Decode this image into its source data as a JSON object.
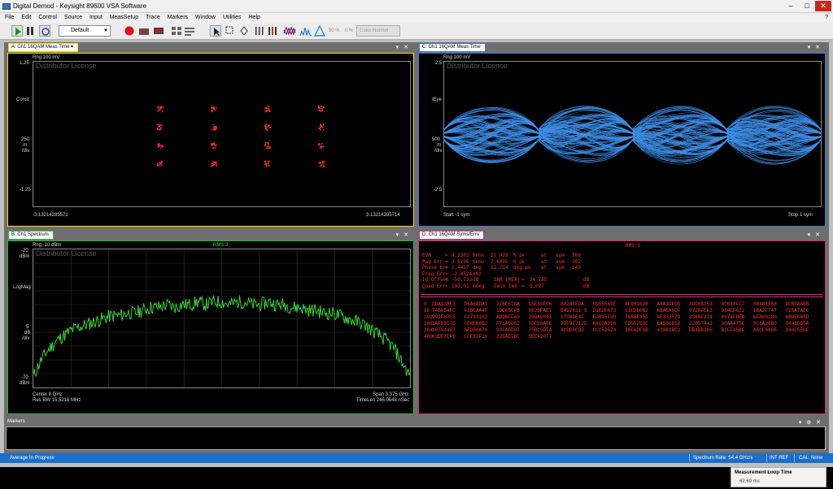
{
  "window": {
    "title": "Digital Demod - Keysight 89600 VSA Software"
  },
  "menu": [
    "File",
    "Edit",
    "Control",
    "Source",
    "Input",
    "MeasSetup",
    "Trace",
    "Markers",
    "Window",
    "Utilities",
    "Help"
  ],
  "toolbar": {
    "preset_value": "Default",
    "percent1": "50 %",
    "percent2": "0 %",
    "color_mode": "Color Normal"
  },
  "pane_a": {
    "tab": "A: Ch1 16QAM Meas Time",
    "range": "Rng 100 mV",
    "license": "Distributor License",
    "y_labels": [
      "1.25",
      "Const",
      "250",
      "m",
      "/div",
      "-1.25"
    ],
    "x_start": "-3.13214285571",
    "x_stop": "3.13214285714"
  },
  "pane_c": {
    "tab": "C: Ch1 16QAM Meas Time",
    "range": "Rng 100 mV",
    "license": "Distributor License",
    "y_labels": [
      "2.5",
      "IEye",
      "500",
      "m",
      "/div",
      "-2.5"
    ],
    "x_start": "Start -1  sym",
    "x_stop": "Stop 1  sym"
  },
  "pane_b": {
    "tab": "B: Ch1 Spectrum",
    "range": "Rng -10 dBm",
    "rms": "RMS:3",
    "license": "Distributor License",
    "y_labels": [
      "-20",
      "dBm",
      "LogMag",
      "5",
      "dB",
      "/div",
      "-70",
      "dBm"
    ],
    "center": "Center 8 GHz",
    "res_bw": "Res BW 15.5218 MHz",
    "span": "Span 3.375 GHz",
    "timelen": "TimeLen 246.0648 nSec"
  },
  "pane_d": {
    "tab": "D: Ch1 16QAM Syms/Errs",
    "rms": "RMS:3",
    "stats": [
      [
        "EVM",
        "=",
        "4.3382",
        "%rms",
        "11.039",
        "% pk",
        "at",
        "sym",
        "360"
      ],
      [
        "Mag Err",
        "=",
        "2.8795",
        "%rms",
        "7.6495",
        "% pk",
        "at",
        "sym",
        "382"
      ],
      [
        "Phase Err",
        "=",
        "2.4417",
        "deg",
        "12.724",
        "deg pk",
        "at",
        "sym",
        "149"
      ],
      [
        "Freq Err",
        "=",
        "-2.4524",
        "kHz",
        "",
        "",
        "",
        "",
        ""
      ],
      [
        "IQ Offset",
        "=",
        "-50.733",
        "dB",
        "SNR (MER)",
        "=",
        "24.785",
        "dB",
        ""
      ],
      [
        "Quad Err",
        "=",
        "193.01",
        "mdeg",
        "Gain Imb",
        "=",
        "0.027",
        "dB",
        ""
      ]
    ],
    "symbols": [
      [
        "0",
        "DDA13BE3",
        "D6A6BDA3",
        "27BC616A",
        "1BE39FC6",
        "B0287EDA",
        "CD55569E",
        "9F981698",
        "A4A3DFD8",
        "1DD0B153",
        "4C618FC7",
        "8B4B1588",
        "DCB0A6BB"
      ],
      [
        "96",
        "74B054FC",
        "F1BCAA4F",
        "1DC65CFB",
        "8820FAE7",
        "B497811 9",
        "D1E2E673",
        "51ED60B2",
        "6BA6A6DF",
        "9720FEF3",
        "984EF622",
        "1BA2F747",
        "725A7AEC"
      ],
      [
        "192",
        "991F8853",
        "C2733183",
        "AD9BFF40",
        "298A6893",
        "17C0DE4F",
        "EDD15F9D",
        "768BE35D",
        "0E33357D",
        "2369F234",
        "8674FBEA",
        "6FB09180",
        "8BDE0B0D"
      ],
      [
        "288",
        "1AFB8C7E",
        "CE8EB8B2",
        "F71A6D02",
        "7DCE8A0E",
        "99F92712D",
        "A810A990",
        "CD55769C",
        "6AD6CB58",
        "22657443",
        "30AA475E",
        "8C6A26B0",
        "044BDD5A"
      ],
      [
        "384",
        "16754497",
        "5ED56A78",
        "98FA0D07",
        "75BC5DFA",
        "4CDD6C9D",
        "CCC52624",
        "38F6DF6B",
        "430B1BC2",
        "DB4BB385",
        "B2FF45BF",
        "A5CF666B",
        "994C55BF"
      ],
      [
        "480",
        "03DC7EF9",
        "CCF52F16",
        "325AE9BC",
        "5EE42077",
        "",
        "",
        "",
        "",
        "",
        "",
        "",
        ""
      ]
    ]
  },
  "markers_panel": {
    "title": "Markers"
  },
  "status": {
    "message": "Average In Progress",
    "spectrum_rate": "Spectrum Rate: 54.4 GHz/s",
    "ref": "INT REF",
    "cal": "CAL: None"
  },
  "toast": {
    "title": "Measurement Loop Time",
    "value": "62.69 ms"
  },
  "chart_data": [
    {
      "type": "scatter",
      "title": "A: Ch1 16QAM Meas Time",
      "xlim": [
        -3.13214285571,
        3.13214285714
      ],
      "ylim": [
        -1.25,
        1.25
      ],
      "constellation_points": [
        [
          -3,
          3
        ],
        [
          -1,
          3
        ],
        [
          1,
          3
        ],
        [
          3,
          3
        ],
        [
          -3,
          1
        ],
        [
          -1,
          1
        ],
        [
          1,
          1
        ],
        [
          3,
          1
        ],
        [
          -3,
          -1
        ],
        [
          -1,
          -1
        ],
        [
          1,
          -1
        ],
        [
          3,
          -1
        ],
        [
          -3,
          -3
        ],
        [
          -1,
          -3
        ],
        [
          1,
          -3
        ],
        [
          3,
          -3
        ]
      ]
    },
    {
      "type": "line",
      "title": "B: Ch1 Spectrum",
      "ylabel": "LogMag",
      "ylim": [
        -70,
        -20
      ],
      "x_center_ghz": 8,
      "x_span_ghz": 3.375,
      "values": [
        -66,
        -60,
        -56,
        -53,
        -51,
        -49,
        -48,
        -47,
        -46,
        -45,
        -44,
        -44,
        -43,
        -43,
        -42,
        -41,
        -41,
        -40,
        -41,
        -40,
        -40,
        -39,
        -40,
        -39,
        -39,
        -40,
        -39,
        -39,
        -40,
        -40,
        -39,
        -40,
        -40,
        -41,
        -41,
        -42,
        -42,
        -43,
        -43,
        -44,
        -45,
        -46,
        -47,
        -49,
        -51,
        -53,
        -56,
        -61,
        -66
      ]
    }
  ],
  "colors": {
    "accent_a": "#f5e000",
    "accent_b": "#2ebf2e",
    "accent_c": "#3b7bd9",
    "accent_d": "#d42d7a",
    "trace": "#39e639",
    "symbols": "#ff2a2a",
    "eye": "#3d8ee8"
  }
}
